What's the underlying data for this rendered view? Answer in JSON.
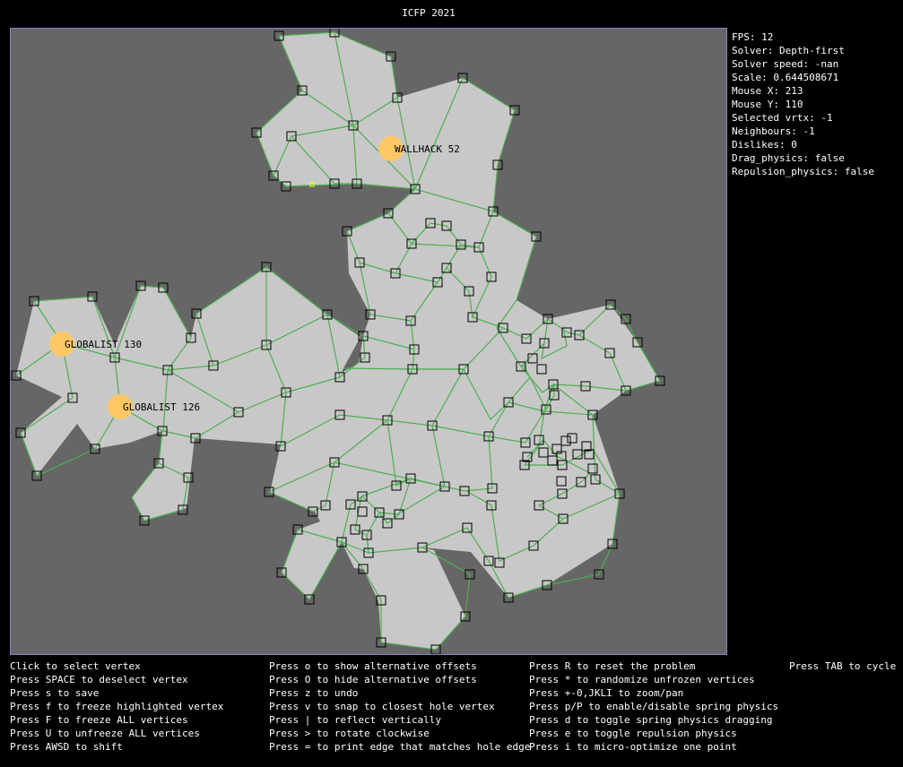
{
  "window": {
    "title": "ICFP 2021"
  },
  "stats": {
    "fps": "FPS: 12",
    "solver": "Solver: Depth-first",
    "solver_speed": "Solver speed: -nan",
    "scale": "Scale: 0.644508671",
    "mouse_x": "Mouse X: 213",
    "mouse_y": "Mouse Y: 110",
    "selected_vertex": "Selected vrtx: -1",
    "neighbours": "Neighbours: -1",
    "dislikes": "Dislikes: 0",
    "drag_physics": "Drag_physics: false",
    "repulsion_physics": "Repulsion_physics: false"
  },
  "bonuses": [
    {
      "label": "WALLHACK 52"
    },
    {
      "label": "GLOBALIST 130"
    },
    {
      "label": "GLOBALIST 126"
    }
  ],
  "colors": {
    "hole_fill": "#c8c8c8",
    "background": "#666666",
    "edge": "#4caf50",
    "bonus": "#ffc864",
    "border": "#8282c8"
  },
  "help": {
    "col1": [
      "Click to select vertex",
      "Press SPACE to deselect vertex",
      "Press s to save",
      "Press f to freeze highlighted vertex",
      "Press F to freeze ALL vertices",
      "Press U to unfreeze ALL vertices",
      "Press AWSD to shift"
    ],
    "col2": [
      "Press o to show alternative offsets",
      "Press O to hide alternative offsets",
      "Press z to undo",
      "Press v to snap to closest hole vertex",
      "Press | to reflect vertically",
      "Press > to rotate clockwise",
      "Press = to print edge that matches hole edge"
    ],
    "col3": [
      "Press R to reset the problem",
      "Press * to randomize unfrozen vertices",
      "Press +-0,JKLI to zoom/pan",
      "Press p/P to enable/disable spring physics",
      "Press d to toggle spring physics dragging",
      "Press e to toggle repulsion physics",
      "Press i to micro-optimize one point"
    ],
    "col4": [
      "Press TAB to cycle s"
    ]
  }
}
